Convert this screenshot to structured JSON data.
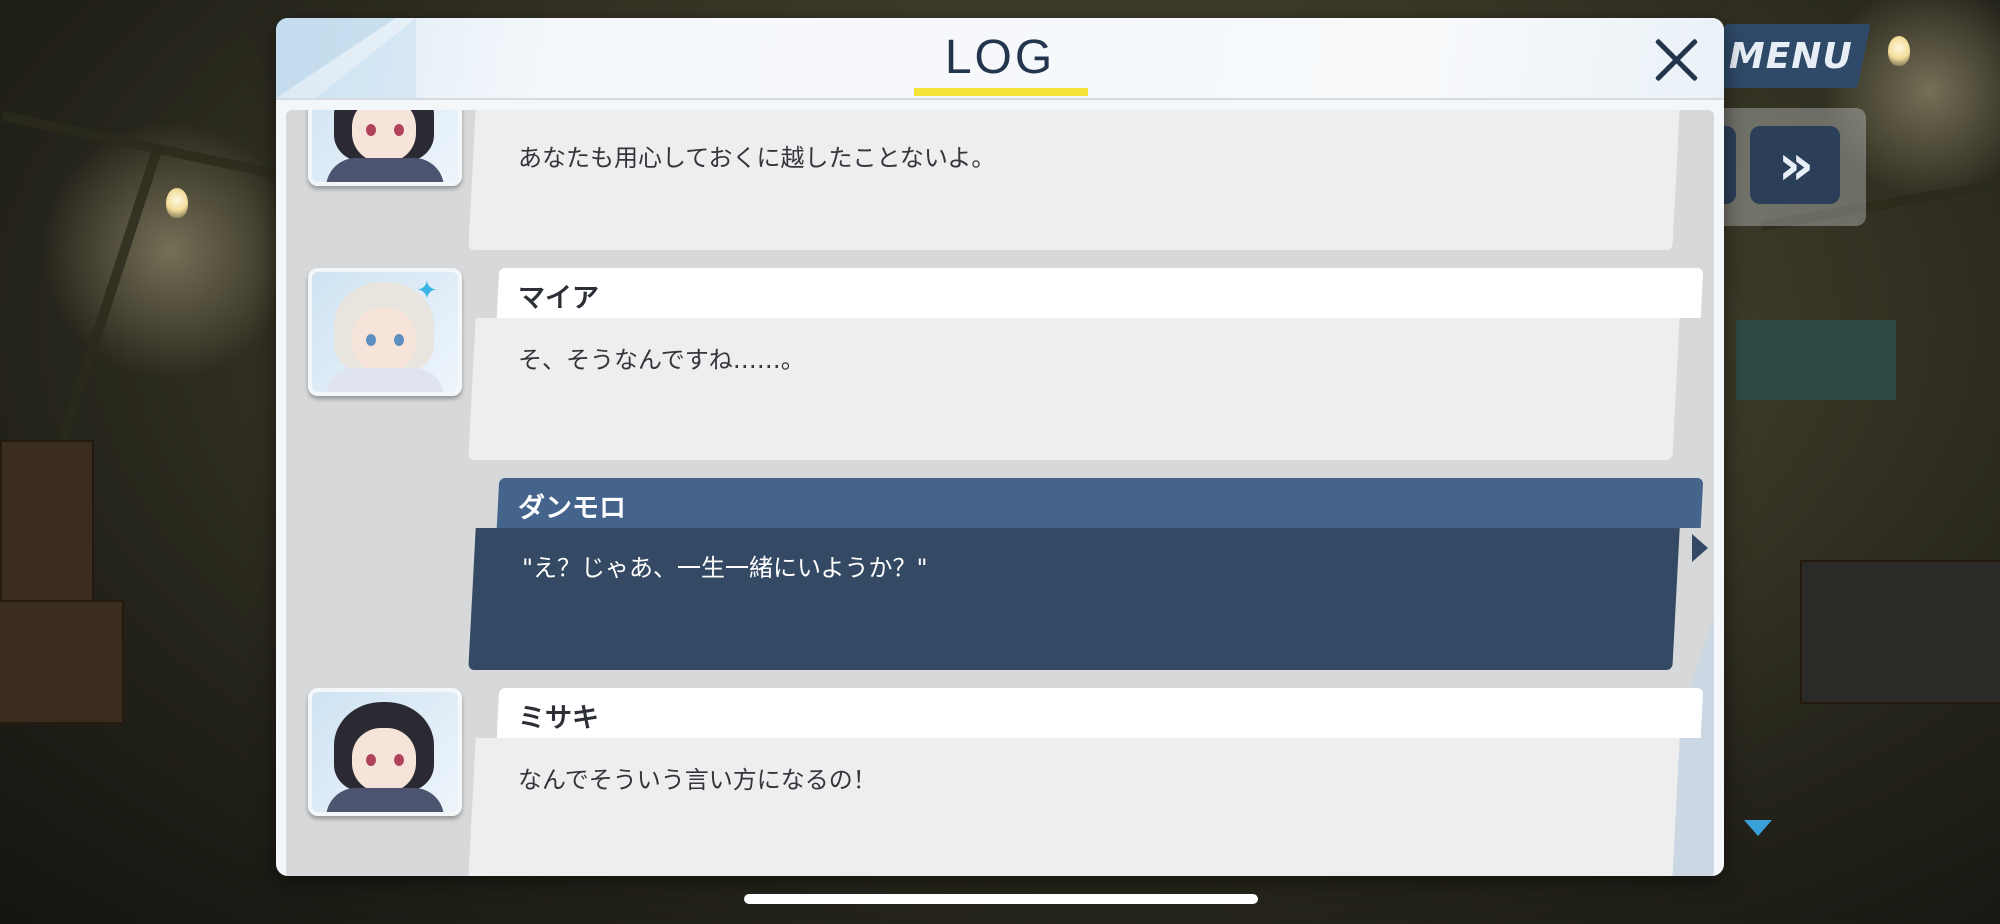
{
  "hud": {
    "menu_label": "MENU",
    "skip_label": "»"
  },
  "log": {
    "title": "LOG",
    "entries": [
      {
        "speaker": "",
        "text": "あなたも用心しておくに越したことないよ。",
        "portrait": "misaki-portrait"
      },
      {
        "speaker": "マイア",
        "text": "そ、そうなんですね……。",
        "portrait": "maia-portrait"
      },
      {
        "speaker": "ダンモロ",
        "text": "\"え？じゃあ、一生一緒にいようか？\"",
        "portrait": ""
      },
      {
        "speaker": "ミサキ",
        "text": "なんでそういう言い方になるの！",
        "portrait": "misaki-portrait"
      }
    ]
  },
  "colors": {
    "player_bubble": "#344963",
    "player_name_tab": "#44648c",
    "title_underline": "#f5e53a",
    "title_text": "#23344d"
  }
}
